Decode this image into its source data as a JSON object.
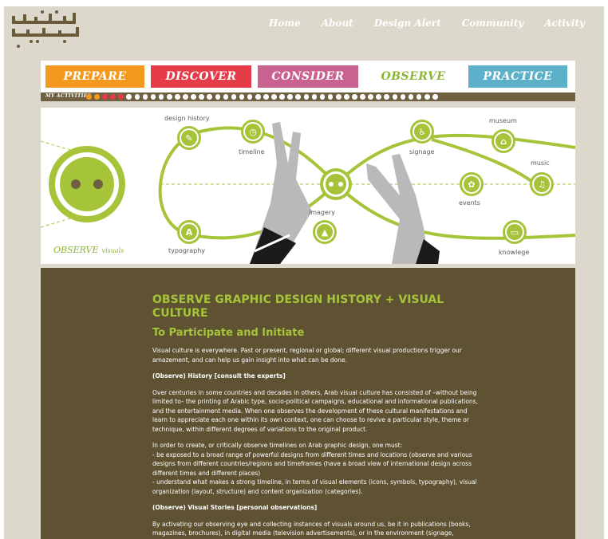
{
  "logo": {
    "glyph_color": "#6a5a3a"
  },
  "nav": {
    "items": [
      {
        "label": "Home"
      },
      {
        "label": "About"
      },
      {
        "label": "Design Alert"
      },
      {
        "label": "Community"
      },
      {
        "label": "Activity"
      }
    ]
  },
  "tabs": [
    {
      "label": "PREPARE",
      "color": "#f39a1e"
    },
    {
      "label": "DISCOVER",
      "color": "#e63c4a"
    },
    {
      "label": "CONSIDER",
      "color": "#c9628e"
    },
    {
      "label": "OBSERVE",
      "color": "#ffffff",
      "text_color": "#8fb53a",
      "active": true
    },
    {
      "label": "PRACTICE",
      "color": "#5cb0c9"
    }
  ],
  "activities": {
    "label": "MY ACTIVITIES",
    "dots": [
      "orange",
      "orange",
      "red",
      "red",
      "red",
      "white",
      "white",
      "white",
      "white",
      "white",
      "white",
      "white",
      "white",
      "white",
      "white",
      "white",
      "white",
      "white",
      "white",
      "white",
      "white",
      "white",
      "white",
      "white",
      "white",
      "white",
      "white",
      "white",
      "white",
      "white",
      "white",
      "white",
      "white",
      "white",
      "white",
      "white",
      "white",
      "white",
      "white",
      "white",
      "white",
      "white",
      "white",
      "white"
    ]
  },
  "illustration": {
    "nodes": [
      {
        "label": "design history",
        "icon": "design-history-icon"
      },
      {
        "label": "timeline",
        "icon": "timeline-icon"
      },
      {
        "label": "signage",
        "icon": "signage-icon"
      },
      {
        "label": "museum",
        "icon": "museum-icon"
      },
      {
        "label": "music",
        "icon": "music-icon"
      },
      {
        "label": "events",
        "icon": "events-icon"
      },
      {
        "label": "imagery",
        "icon": "imagery-icon"
      },
      {
        "label": "typography",
        "icon": "typography-icon"
      },
      {
        "label": "knowlege",
        "icon": "knowledge-icon"
      }
    ],
    "caption_main": "OBSERVE",
    "caption_sub": "visuals",
    "accent": "#a6c43a"
  },
  "article": {
    "title": "OBSERVE GRAPHIC DESIGN HISTORY + VISUAL CULTURE",
    "subtitle": "To Participate and Initiate",
    "intro": "Visual culture is everywhere. Past or present, regional or global; different visual productions trigger our amazement, and can help us gain insight into what can be done.",
    "h_history": "(Observe) History [consult the experts]",
    "p_history": "Over centuries in some countries and decades in others, Arab visual culture has consisted of –without being limited to– the printing of Arabic type, socio-political campaigns, educational and informational publications, and the entertainment media. When one observes the development of these cultural manifestations and learn to appreciate each one within its own context, one can choose to revive a particular style, theme or technique, within different degrees of variations to the original product.",
    "p_timelines_1": "In order to create, or critically observe timelines on Arab graphic design, one must:",
    "p_timelines_2": "- be exposed to a broad range of powerful designs from different times and locations (observe and various designs from different countries/regions and timeframes (have a broad view of international design across different times and different places)",
    "p_timelines_3": "- understand what makes a strong timeline, in terms of visual elements (icons, symbols, typography), visual organization (layout, structure) and content organization (categories).",
    "h_stories": "(Observe) Visual Stories [personal observations]",
    "p_stories": "By activating our observing eye and collecting instances of visuals around us, be it in publications (books, magazines, brochures), in digital media (television advertisements), or in the environment (signage, billboards, graffiti), we can start capturing characteristics of contemporary Arab visual culture. When we understand these"
  }
}
